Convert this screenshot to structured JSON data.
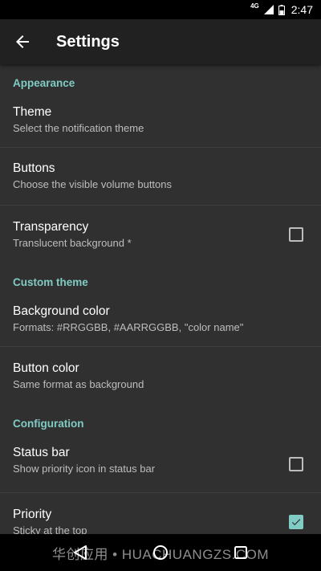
{
  "status_bar": {
    "network": "4G",
    "time": "2:47"
  },
  "toolbar": {
    "title": "Settings"
  },
  "sections": {
    "appearance": {
      "header": "Appearance",
      "theme": {
        "title": "Theme",
        "summary": "Select the notification theme"
      },
      "buttons": {
        "title": "Buttons",
        "summary": "Choose the visible volume buttons"
      },
      "transparency": {
        "title": "Transparency",
        "summary": "Translucent background *",
        "checked": false
      }
    },
    "custom_theme": {
      "header": "Custom theme",
      "background_color": {
        "title": "Background color",
        "summary": "Formats: #RRGGBB, #AARRGGBB, \"color name\""
      },
      "button_color": {
        "title": "Button color",
        "summary": "Same format as background"
      }
    },
    "configuration": {
      "header": "Configuration",
      "status_bar": {
        "title": "Status bar",
        "summary": "Show priority icon in status bar",
        "checked": false
      },
      "priority": {
        "title": "Priority",
        "summary": "Sticky at the top",
        "checked": true
      }
    }
  },
  "watermark": "华创应用 • HUACHUANGZS.COM",
  "colors": {
    "accent": "#80cbc4",
    "background": "#303030",
    "toolbar": "#212121"
  }
}
